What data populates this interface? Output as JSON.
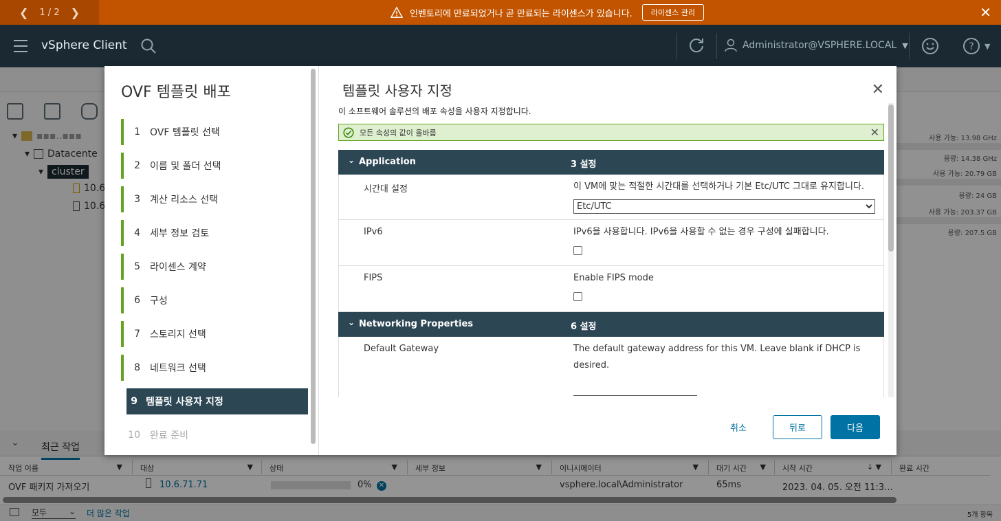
{
  "alert": {
    "pager": "1 / 2",
    "message": "인벤토리에 만료되었거나 곧 만료되는 라이센스가 있습니다.",
    "action_label": "라이센스 관리"
  },
  "header": {
    "app_title": "vSphere Client",
    "user": "Administrator@VSPHERE.LOCAL"
  },
  "tree": {
    "datacenter": "Datacente",
    "cluster": "cluster",
    "host1": "10.6",
    "host2": "10.6"
  },
  "right_stats": [
    "사용 가능: 13.98 GHz",
    "용량: 14.38 GHz",
    "사용 가능: 20.79 GB",
    "용량: 24 GB",
    "사용 가능: 203.37 GB",
    "용량: 207.5 GB"
  ],
  "wizard": {
    "title": "OVF 템플릿 배포",
    "steps": [
      {
        "num": "1",
        "label": "OVF 템플릿 선택"
      },
      {
        "num": "2",
        "label": "이름 및 폴더 선택"
      },
      {
        "num": "3",
        "label": "계산 리소스 선택"
      },
      {
        "num": "4",
        "label": "세부 정보 검토"
      },
      {
        "num": "5",
        "label": "라이센스 계약"
      },
      {
        "num": "6",
        "label": "구성"
      },
      {
        "num": "7",
        "label": "스토리지 선택"
      },
      {
        "num": "8",
        "label": "네트워크 선택"
      },
      {
        "num": "9",
        "label": "템플릿 사용자 지정"
      },
      {
        "num": "10",
        "label": "완료 준비"
      }
    ],
    "page_title": "템플릿 사용자 지정",
    "subtitle": "이 소프트웨어 솔루션의 배포 속성을 사용자 지정합니다.",
    "success_msg": "모든 속성의 값이 올바름",
    "groups": [
      {
        "name": "Application",
        "count": "3 설정"
      },
      {
        "name": "Networking Properties",
        "count": "6 설정"
      }
    ],
    "props": {
      "timezone": {
        "name": "시간대 설정",
        "desc": "이 VM에 맞는 적절한 시간대를 선택하거나 기본 Etc/UTC 그대로 유지합니다.",
        "value": "Etc/UTC"
      },
      "ipv6": {
        "name": "IPv6",
        "desc": "IPv6을 사용합니다. IPv6을 사용할 수 없는 경우 구성에 실패합니다."
      },
      "fips": {
        "name": "FIPS",
        "desc": "Enable FIPS mode"
      },
      "gateway": {
        "name": "Default Gateway",
        "desc": "The default gateway address for this VM. Leave blank if DHCP is desired."
      }
    },
    "buttons": {
      "cancel": "취소",
      "back": "뒤로",
      "next": "다음"
    }
  },
  "tasks": {
    "tab": "최근 작업",
    "columns": [
      "작업 이름",
      "대상",
      "상태",
      "세부 정보",
      "이니시에이터",
      "대기 시간",
      "시작 시간",
      "완료 시간"
    ],
    "row": {
      "name": "OVF 패키지 가져오기",
      "target": "10.6.71.71",
      "status": "0%",
      "initiator": "vsphere.local\\Administrator",
      "wait": "65ms",
      "start": "2023. 04. 05. 오전 11:3..."
    },
    "filter": "모두",
    "more": "더 많은 작업",
    "count": "5개 항목"
  }
}
